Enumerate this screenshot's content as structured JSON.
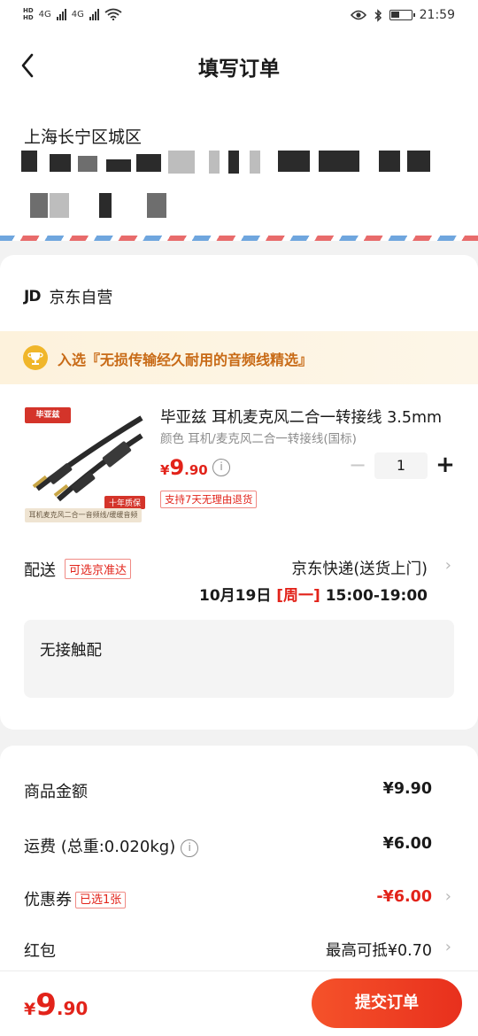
{
  "status_bar": {
    "time": "21:59",
    "net_1": "4G",
    "net_2": "4G",
    "hd_1": "HD",
    "hd_2": "HD"
  },
  "nav": {
    "title": "填写订单"
  },
  "address": {
    "region": "上海长宁区城区"
  },
  "shop": {
    "logo": "JD",
    "name": "京东自营",
    "promo": "入选『无损传输经久耐用的音频线精选』"
  },
  "product": {
    "thumb_brand": "毕亚兹",
    "thumb_tag": "十年质保",
    "thumb_caption": "耳机麦克风二合一音频线/缓缓音频",
    "title": "毕亚兹 耳机麦克风二合一转接线 3.5mm",
    "spec": "颜色 耳机/麦克风二合一转接线(国标)",
    "price_symbol": "¥",
    "price_int": "9",
    "price_dec": ".90",
    "quantity": "1",
    "minus": "−",
    "plus": "+",
    "return_policy": "支持7天无理由退货"
  },
  "delivery": {
    "label": "配送",
    "badge": "可选京准达",
    "method": "京东快递(送货上门)",
    "date": "10月19日",
    "weekday": "[周一]",
    "slot": "15:00-19:00"
  },
  "note": {
    "text": "无接触配"
  },
  "summary": {
    "goods_label": "商品金额",
    "goods_value": "¥9.90",
    "freight_label": "运费 (总重:0.020kg)",
    "freight_value": "¥6.00",
    "coupon_label": "优惠券",
    "coupon_badge": "已选1张",
    "coupon_value": "-¥6.00",
    "redpacket_label": "红包",
    "redpacket_value": "最高可抵¥0.70"
  },
  "bottom": {
    "total_symbol": "¥",
    "total_int": "9",
    "total_dec": ".90",
    "submit_label": "提交订单"
  },
  "colors": {
    "accent": "#e2231a",
    "promo_text": "#c86a16",
    "promo_bg": "#fdf2dc"
  },
  "icons": [
    "back-icon",
    "eye-icon",
    "bluetooth-icon",
    "battery-icon",
    "wifi-icon",
    "signal-icon",
    "trophy-icon",
    "info-icon",
    "chevron-right-icon"
  ]
}
